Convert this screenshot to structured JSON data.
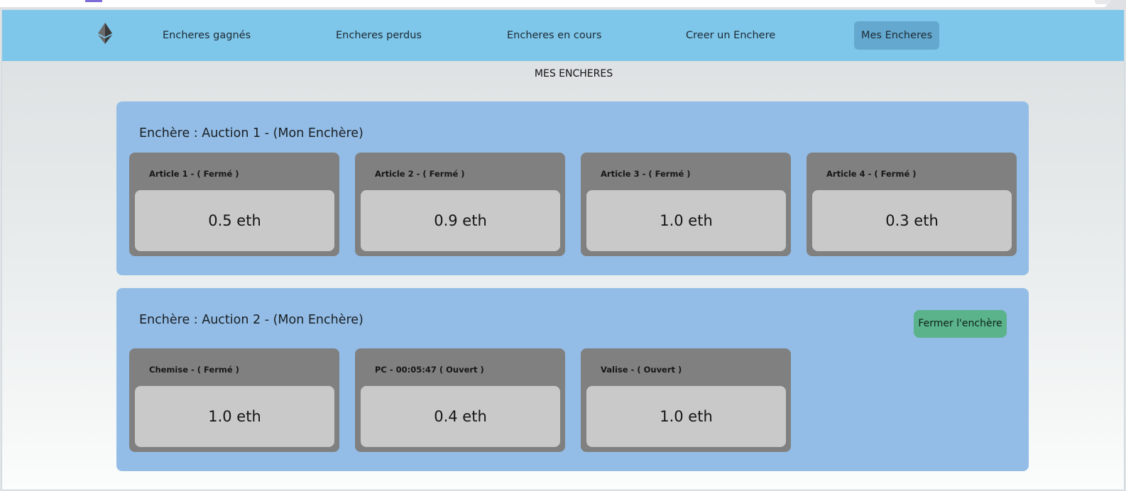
{
  "browser": {},
  "nav": {
    "logo_icon": "ethereum-icon",
    "items": [
      {
        "label": "Encheres gagnés"
      },
      {
        "label": "Encheres perdus"
      },
      {
        "label": "Encheres en cours"
      },
      {
        "label": "Creer un Enchere"
      },
      {
        "label": "Mes Encheres",
        "active": true
      }
    ]
  },
  "page": {
    "title": "MES ENCHERES"
  },
  "auctions": [
    {
      "title": "Enchère : Auction 1 - (Mon Enchère)",
      "articles": [
        {
          "title": "Article 1 - ( Fermé )",
          "price": "0.5 eth"
        },
        {
          "title": "Article 2 - ( Fermé )",
          "price": "0.9 eth"
        },
        {
          "title": "Article 3 - ( Fermé )",
          "price": "1.0 eth"
        },
        {
          "title": "Article 4 - ( Fermé )",
          "price": "0.3 eth"
        }
      ]
    },
    {
      "title": "Enchère : Auction 2 - (Mon Enchère)",
      "close_button": "Fermer l'enchère",
      "articles": [
        {
          "title": "Chemise - ( Fermé )",
          "price": "1.0 eth"
        },
        {
          "title": "PC - 00:05:47 ( Ouvert )",
          "price": "0.4 eth"
        },
        {
          "title": "Valise - ( Ouvert )",
          "price": "1.0 eth"
        }
      ]
    }
  ],
  "colors": {
    "navbar": "#7ec6ea",
    "nav_active": "#64a8cf",
    "auction_panel": "#93bde6",
    "card": "#808080",
    "price_box": "#c9c9c9",
    "close_button": "#5ab38a"
  }
}
